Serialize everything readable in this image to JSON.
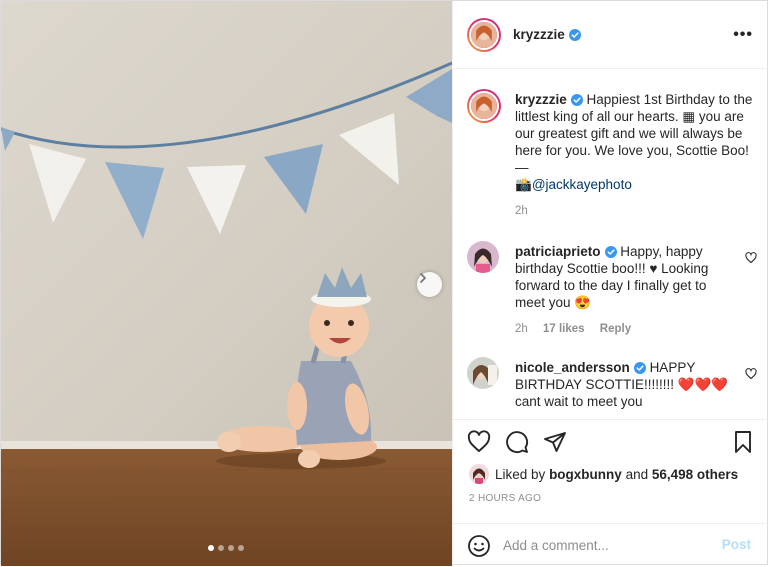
{
  "post": {
    "author": "kryzzzie",
    "more_label": "•••",
    "carousel": {
      "total_slides": 4,
      "active_slide": 1,
      "next_icon": "chevron-right-icon"
    }
  },
  "caption": {
    "username": "kryzzzie",
    "lines": [
      "Happiest 1st Birthday to the",
      "littlest king of all our hearts. ▦ you are",
      "our greatest gift and we will always be",
      "here for you. We love you, Scottie Boo!",
      "—"
    ],
    "credit_emoji": "📸",
    "credit_tag": "@jackkayephoto",
    "time": "2h"
  },
  "comments": [
    {
      "username": "patriciaprieto",
      "lines": [
        "Happy, happy",
        "birthday Scottie boo!!! ♥ Looking",
        "forward to the day I finally get to",
        "meet you 😍"
      ],
      "time": "2h",
      "likes": "17 likes",
      "reply": "Reply"
    },
    {
      "username": "nicole_andersson",
      "lines": [
        "HAPPY",
        "BIRTHDAY SCOTTIE!!!!!!!! ❤️❤️❤️",
        "cant wait to meet you"
      ]
    }
  ],
  "likes": {
    "prefix": "Liked by",
    "liker": "bogxbunny",
    "and": "and",
    "count": "56,498 others"
  },
  "timestamp": "2 HOURS AGO",
  "add_comment": {
    "placeholder": "Add a comment...",
    "post_label": "Post"
  },
  "colors": {
    "verified": "#3897f0",
    "link": "#00376b",
    "post_disabled": "#b2dffc",
    "heart_red": "#ed4956"
  }
}
